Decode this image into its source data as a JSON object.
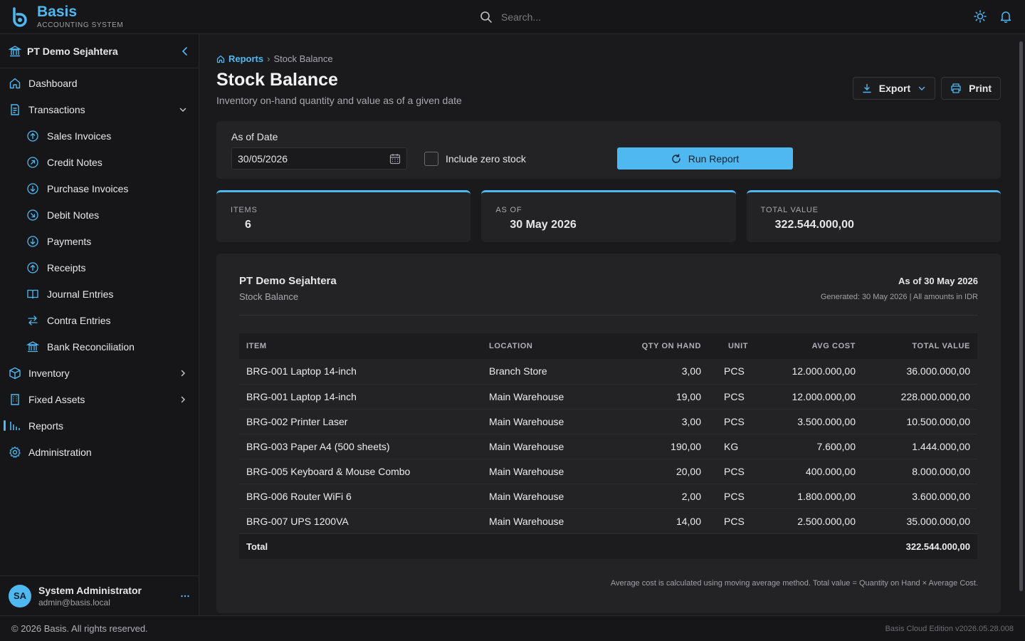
{
  "app": {
    "name": "Basis",
    "subtitle": "ACCOUNTING SYSTEM"
  },
  "search": {
    "placeholder": "Search..."
  },
  "sidebar": {
    "company": "PT Demo Sejahtera",
    "items": [
      {
        "label": "Dashboard"
      },
      {
        "label": "Transactions"
      },
      {
        "label": "Sales Invoices"
      },
      {
        "label": "Credit Notes"
      },
      {
        "label": "Purchase Invoices"
      },
      {
        "label": "Debit Notes"
      },
      {
        "label": "Payments"
      },
      {
        "label": "Receipts"
      },
      {
        "label": "Journal Entries"
      },
      {
        "label": "Contra Entries"
      },
      {
        "label": "Bank Reconciliation"
      },
      {
        "label": "Inventory"
      },
      {
        "label": "Fixed Assets"
      },
      {
        "label": "Reports"
      },
      {
        "label": "Administration"
      }
    ],
    "user": {
      "initials": "SA",
      "name": "System Administrator",
      "email": "admin@basis.local"
    }
  },
  "page": {
    "breadcrumb_parent": "Reports",
    "breadcrumb_sep": "›",
    "breadcrumb_current": "Stock Balance",
    "title": "Stock Balance",
    "subtitle": "Inventory on-hand quantity and value as of a given date",
    "export_label": "Export",
    "print_label": "Print"
  },
  "filter": {
    "date_label": "As of Date",
    "date_value": "30/05/2026",
    "include_zero_label": "Include zero stock",
    "run_label": "Run Report"
  },
  "stats": [
    {
      "label": "ITEMS",
      "value": "6"
    },
    {
      "label": "AS OF",
      "value": "30 May 2026"
    },
    {
      "label": "TOTAL VALUE",
      "value": "322.544.000,00"
    }
  ],
  "report": {
    "company": "PT Demo Sejahtera",
    "report_name": "Stock Balance",
    "as_of": "As of 30 May 2026",
    "generated": "Generated: 30 May 2026 | All amounts in IDR",
    "columns": [
      "ITEM",
      "LOCATION",
      "QTY ON HAND",
      "UNIT",
      "AVG COST",
      "TOTAL VALUE"
    ],
    "rows": [
      [
        "BRG-001  Laptop 14-inch",
        "Branch Store",
        "3,00",
        "PCS",
        "12.000.000,00",
        "36.000.000,00"
      ],
      [
        "BRG-001  Laptop 14-inch",
        "Main Warehouse",
        "19,00",
        "PCS",
        "12.000.000,00",
        "228.000.000,00"
      ],
      [
        "BRG-002  Printer Laser",
        "Main Warehouse",
        "3,00",
        "PCS",
        "3.500.000,00",
        "10.500.000,00"
      ],
      [
        "BRG-003  Paper A4 (500 sheets)",
        "Main Warehouse",
        "190,00",
        "KG",
        "7.600,00",
        "1.444.000,00"
      ],
      [
        "BRG-005  Keyboard & Mouse Combo",
        "Main Warehouse",
        "20,00",
        "PCS",
        "400.000,00",
        "8.000.000,00"
      ],
      [
        "BRG-006  Router WiFi 6",
        "Main Warehouse",
        "2,00",
        "PCS",
        "1.800.000,00",
        "3.600.000,00"
      ],
      [
        "BRG-007  UPS 1200VA",
        "Main Warehouse",
        "14,00",
        "PCS",
        "2.500.000,00",
        "35.000.000,00"
      ]
    ],
    "total_label": "Total",
    "total_value": "322.544.000,00",
    "note": "Average cost is calculated using moving average method. Total value = Quantity on Hand × Average Cost."
  },
  "footer": {
    "copyright": "© 2026 Basis. All rights reserved.",
    "version": "Basis Cloud Edition v2026.05.28.008"
  },
  "colors": {
    "accent": "#4fb8f0",
    "background": "#1a1a1d",
    "surface": "#232326"
  }
}
